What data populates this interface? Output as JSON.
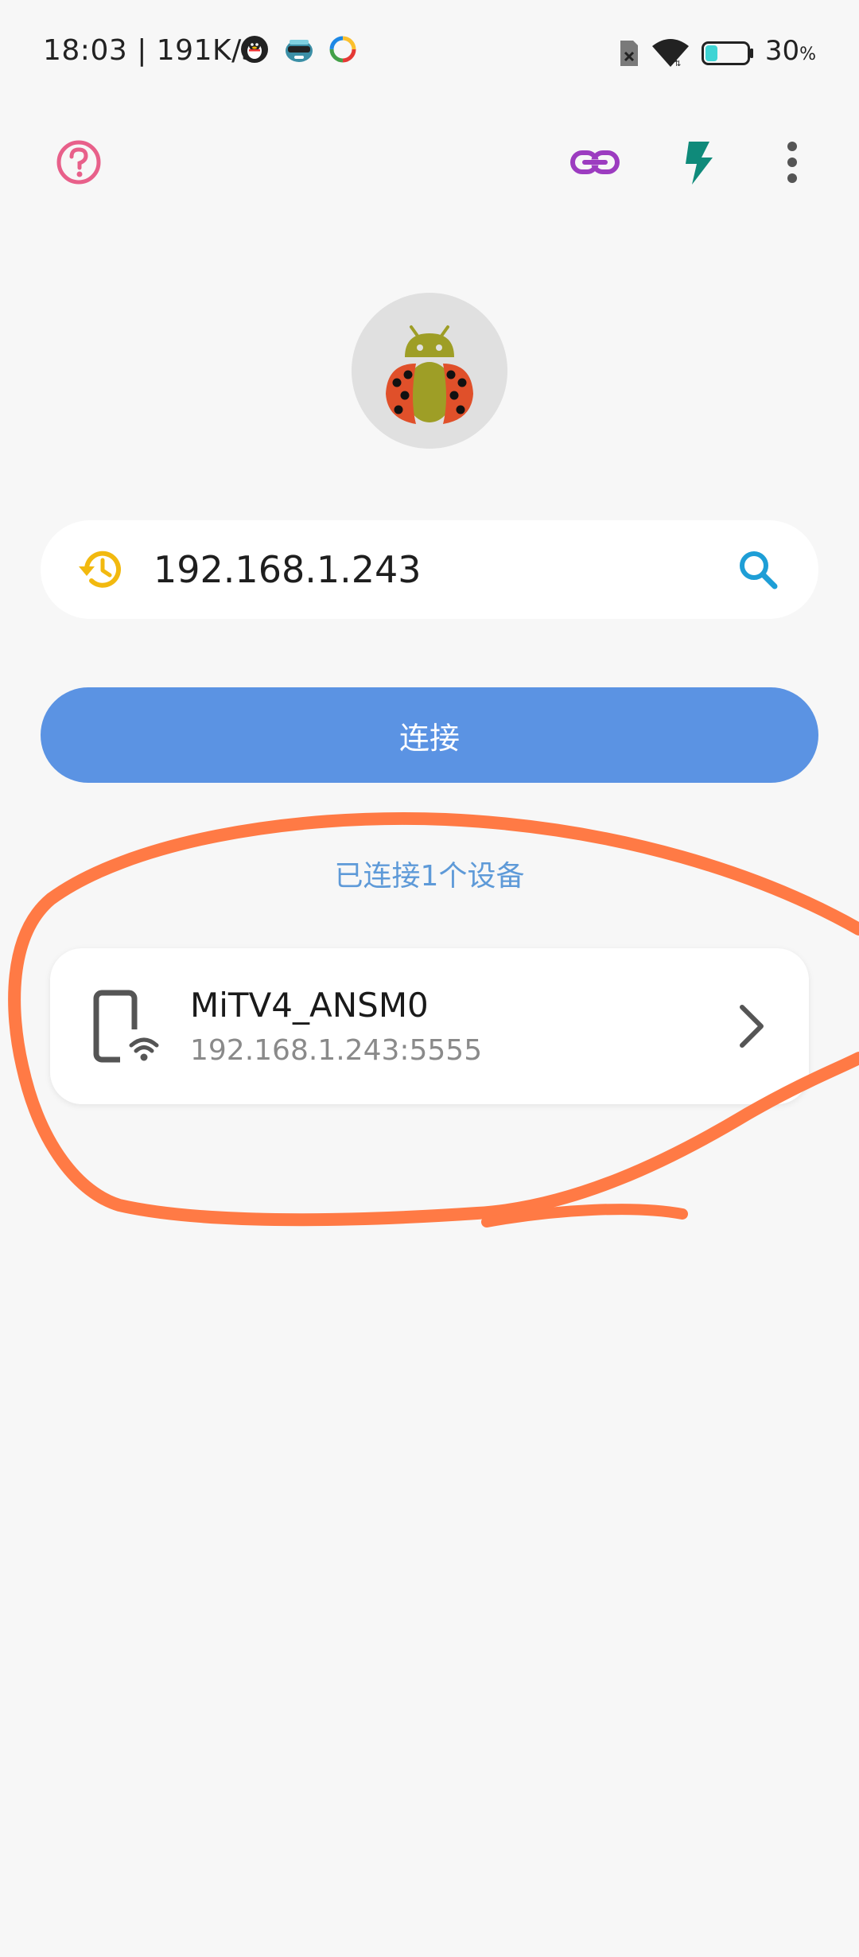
{
  "status_bar": {
    "time": "18:03 | 191K/s",
    "battery_value": "30",
    "battery_unit": "%",
    "battery_level": 0.3,
    "icons": [
      "qq-icon",
      "game-avatar-icon",
      "colorful-app-icon",
      "sim-icon",
      "wifi-icon",
      "battery-icon"
    ]
  },
  "toolbar": {
    "icons": [
      "help-icon",
      "link-icon",
      "flash-icon",
      "more-vert-icon"
    ],
    "colors": {
      "help": "#e8608a",
      "link": "#9c3cc0",
      "flash": "#0f8a7a",
      "more": "#555555"
    }
  },
  "address": {
    "value": "192.168.1.243",
    "history_icon": "history-icon",
    "search_icon": "search-icon"
  },
  "connect_button": {
    "label": "连接",
    "color": "#5b93e3"
  },
  "connected_summary": "已连接1个设备",
  "devices": [
    {
      "name": "MiTV4_ANSM0",
      "address": "192.168.1.243:5555",
      "icon": "phone-wifi-icon"
    }
  ],
  "annotation_color": "#ff7a45"
}
